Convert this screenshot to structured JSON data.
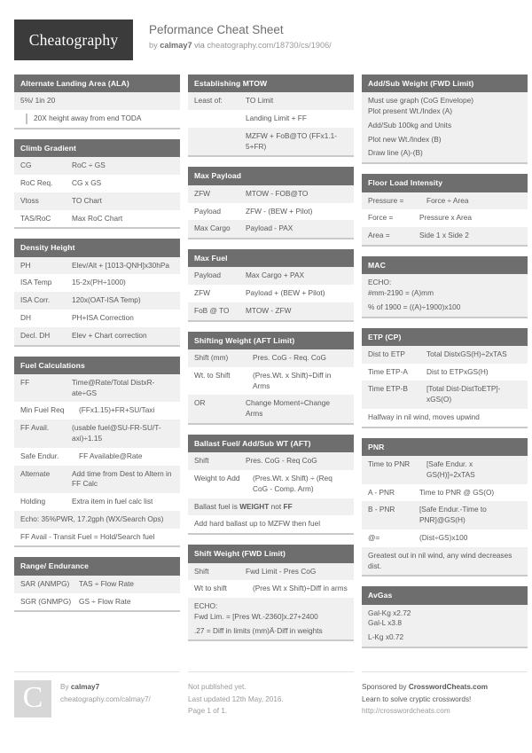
{
  "header": {
    "logo": "Cheatography",
    "title": "Peformance Cheat Sheet",
    "by_prefix": "by",
    "author": "calmay7",
    "via": "via",
    "source_url": "cheatography.com/18730/cs/1906/"
  },
  "columns": [
    {
      "cards": [
        {
          "title": "Alternate Landing Area (ALA)",
          "rows": [
            {
              "type": "note",
              "text": "5%/ 1in 20"
            },
            {
              "type": "quote",
              "text": "20X height away from end TODA"
            }
          ]
        },
        {
          "title": "Climb Gradient",
          "rows": [
            {
              "type": "kv",
              "k": "CG",
              "v": "RoC ÷ GS"
            },
            {
              "type": "kv",
              "k": "RoC Req.",
              "v": "CG x GS"
            },
            {
              "type": "kv",
              "k": "Vtoss",
              "v": "TO Chart"
            },
            {
              "type": "kv",
              "k": "TAS/RoC",
              "v": "Max RoC Chart"
            }
          ]
        },
        {
          "title": "Density Height",
          "rows": [
            {
              "type": "kv",
              "k": "PH",
              "v": "Elev/Alt + [1013-QNH]x30hPa"
            },
            {
              "type": "kv",
              "k": "ISA Temp",
              "v": "15-2x(PH÷1000)"
            },
            {
              "type": "kv",
              "k": "ISA Corr.",
              "v": "120x(OAT-ISA Temp)"
            },
            {
              "type": "kv",
              "k": "DH",
              "v": "PH+ISA Correction"
            },
            {
              "type": "kv",
              "k": "Decl. DH",
              "v": "Elev + Chart correction"
            }
          ]
        },
        {
          "title": "Fuel Calculations",
          "rows": [
            {
              "type": "kv",
              "k": "FF",
              "v": "Time@Rate/Total DistxR-ate÷GS"
            },
            {
              "type": "kv",
              "k": "Min Fuel Req",
              "v": "(FFx1.15)+FR+SU/Taxi"
            },
            {
              "type": "kv",
              "k": "FF Avail.",
              "v": "(usable fuel@SU-FR-SU/T-axi)÷1.15"
            },
            {
              "type": "kv",
              "k": "Safe Endur.",
              "v": "FF Available@Rate"
            },
            {
              "type": "kv",
              "k": "Alternate",
              "v": "Add time from Dest to Altern in FF Calc"
            },
            {
              "type": "kv",
              "k": "Holding",
              "v": "Extra item in fuel calc list"
            },
            {
              "type": "note",
              "text": "Echo: 35%PWR, 17.2gph (WX/Search Ops)"
            },
            {
              "type": "note",
              "text": "FF Avail - Transit Fuel = Hold/Search fuel"
            }
          ]
        },
        {
          "title": "Range/ Endurance",
          "rows": [
            {
              "type": "kv",
              "k": "SAR (ANMPG)",
              "v": "TAS ÷ Flow Rate"
            },
            {
              "type": "kv",
              "k": "SGR (GNMPG)",
              "v": "GS ÷ Flow Rate"
            }
          ]
        }
      ]
    },
    {
      "cards": [
        {
          "title": "Establishing MTOW",
          "rows": [
            {
              "type": "kv",
              "k": "Least of:",
              "v": "TO Limit"
            },
            {
              "type": "kv",
              "k": "",
              "v": "Landing Limit + FF"
            },
            {
              "type": "kv",
              "k": "",
              "v": "MZFW + FoB@TO (FFx1.1-5+FR)"
            }
          ]
        },
        {
          "title": "Max Payload",
          "rows": [
            {
              "type": "kv",
              "k": "ZFW",
              "v": "MTOW - FOB@TO"
            },
            {
              "type": "kv",
              "k": "Payload",
              "v": "ZFW - (BEW + Pilot)"
            },
            {
              "type": "kv",
              "k": "Max Cargo",
              "v": "Payload - PAX"
            }
          ]
        },
        {
          "title": "Max Fuel",
          "rows": [
            {
              "type": "kv",
              "k": "Payload",
              "v": "Max Cargo + PAX"
            },
            {
              "type": "kv",
              "k": "ZFW",
              "v": "Payload + (BEW + Pilot)"
            },
            {
              "type": "kv",
              "k": "FoB @ TO",
              "v": "MTOW - ZFW"
            }
          ]
        },
        {
          "title": "Shifting Weight (AFT Limit)",
          "rows": [
            {
              "type": "kv",
              "k": "Shift (mm)",
              "v": "Pres. CoG - Req. CoG"
            },
            {
              "type": "kv",
              "k": "Wt. to Shift",
              "v": "(Pres.Wt. x Shift)÷Diff in Arms"
            },
            {
              "type": "kv",
              "k": "OR",
              "v": "Change Moment÷Change Arms"
            }
          ]
        },
        {
          "title": "Ballast Fuel/ Add/Sub WT (AFT)",
          "rows": [
            {
              "type": "kv",
              "k": "Shift",
              "v": "Pres. CoG - Req CoG"
            },
            {
              "type": "kv",
              "k": "Weight to Add",
              "v": "(Pres.Wt. x Shift) ÷ (Req CoG - Comp. Arm)"
            },
            {
              "type": "rich",
              "parts": [
                {
                  "t": "Ballast fuel is ",
                  "b": false
                },
                {
                  "t": "WEIGHT",
                  "b": true
                },
                {
                  "t": " not ",
                  "b": false
                },
                {
                  "t": "FF",
                  "b": true
                }
              ]
            },
            {
              "type": "note",
              "text": "Add hard ballast up to MZFW then fuel"
            }
          ]
        },
        {
          "title": "Shift Weight (FWD Limit)",
          "rows": [
            {
              "type": "kv",
              "k": "Shift",
              "v": "Fwd Limit - Pres CoG"
            },
            {
              "type": "kv",
              "k": "Wt to shift",
              "v": "(Pres Wt x Shift)÷Diff in arms"
            },
            {
              "type": "note",
              "text": "ECHO:"
            },
            {
              "type": "note-plain",
              "text": "Fwd Lim. = [Pres Wt.-2360]x.27+2400"
            },
            {
              "type": "note-plain",
              "text": ".27 = Diff in limits (mm)Ä·Diff in weights"
            }
          ]
        }
      ]
    },
    {
      "cards": [
        {
          "title": "Add/Sub Weight (FWD Limit)",
          "rows": [
            {
              "type": "note",
              "text": "Must use graph (CoG Envelope)"
            },
            {
              "type": "note-plain",
              "text": "Plot present Wt./Index (A)"
            },
            {
              "type": "note-plain",
              "text": "Add/Sub 100kg and Units"
            },
            {
              "type": "note-plain",
              "text": "Plot new Wt./Index (B)"
            },
            {
              "type": "note-plain",
              "text": "Draw line (A)-(B)"
            }
          ]
        },
        {
          "title": "Floor Load Intensity",
          "rows": [
            {
              "type": "kv",
              "k": "Pressure =",
              "v": "Force ÷ Area"
            },
            {
              "type": "kv",
              "k": "Force =",
              "v": "Pressure x Area"
            },
            {
              "type": "kv",
              "k": "Area =",
              "v": "Side 1 x Side 2"
            }
          ]
        },
        {
          "title": "MAC",
          "rows": [
            {
              "type": "note",
              "text": "ECHO:"
            },
            {
              "type": "note-plain",
              "text": "#mm-2190 = (A)mm"
            },
            {
              "type": "note-plain",
              "text": "% of 1900 = ((A)÷1900)x100"
            }
          ]
        },
        {
          "title": "ETP (CP)",
          "rows": [
            {
              "type": "kv",
              "k": "Dist to ETP",
              "v": "Total DistxGS(H)÷2xTAS"
            },
            {
              "type": "kv",
              "k": "Time ETP-A",
              "v": "Dist to ETPxGS(H)"
            },
            {
              "type": "kv",
              "k": "Time ETP-B",
              "v": "[Total Dist-DistToETP]-xGS(O)"
            },
            {
              "type": "note",
              "text": "Halfway in nil wind, moves upwind"
            }
          ]
        },
        {
          "title": "PNR",
          "rows": [
            {
              "type": "kv",
              "k": "Time to PNR",
              "v": "[Safe Endur. x GS(H)]÷2xTAS"
            },
            {
              "type": "kv",
              "k": "A - PNR",
              "v": "Time to PNR @ GS(O)"
            },
            {
              "type": "kv",
              "k": "B - PNR",
              "v": "[Safe Endur.-Time to PNR]@GS(H)"
            },
            {
              "type": "kv",
              "k": "@=",
              "v": "(Dist÷GS)x100"
            },
            {
              "type": "note",
              "text": "Greatest out in nil wind, any wind decreases dist."
            }
          ]
        },
        {
          "title": "AvGas",
          "rows": [
            {
              "type": "note",
              "text": "Gal-Kg x2.72"
            },
            {
              "type": "note-plain",
              "text": "Gal-L x3.8"
            },
            {
              "type": "note-plain",
              "text": "L-Kg x0.72"
            }
          ]
        }
      ]
    }
  ],
  "footer": {
    "logo_letter": "C",
    "by_label": "By",
    "author": "calmay7",
    "author_url": "cheatography.com/calmay7/",
    "publish_status": "Not published yet.",
    "last_updated": "Last updated 12th May, 2016.",
    "page_info": "Page 1 of 1.",
    "sponsor_prefix": "Sponsored by",
    "sponsor_name": "CrosswordCheats.com",
    "sponsor_tagline": "Learn to solve cryptic crosswords!",
    "sponsor_url": "http://crosswordcheats.com"
  }
}
